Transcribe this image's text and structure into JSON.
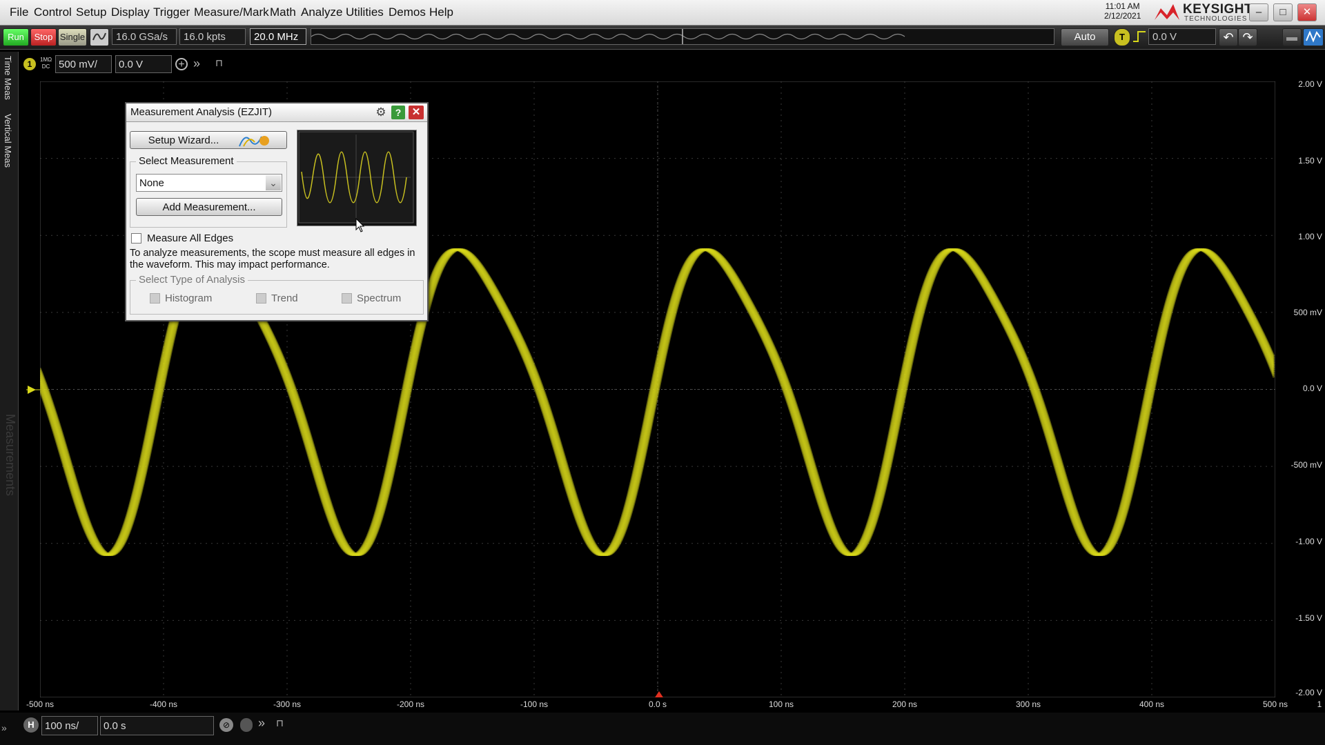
{
  "menu": [
    "File",
    "Control",
    "Setup",
    "Display",
    "Trigger",
    "Measure/Mark",
    "Math",
    "Analyze",
    "Utilities",
    "Demos",
    "Help"
  ],
  "clock": {
    "time": "11:01 AM",
    "date": "2/12/2021"
  },
  "brand": {
    "name": "KEYSIGHT",
    "sub": "TECHNOLOGIES"
  },
  "toolbar": {
    "run": "Run",
    "stop": "Stop",
    "single": "Single",
    "sample_rate": "16.0 GSa/s",
    "memory_depth": "16.0 kpts",
    "bandwidth": "20.0 MHz",
    "trigger_mode": "Auto",
    "trigger_level": "0.0 V",
    "trigger_icon": "T"
  },
  "channel": {
    "number": "1",
    "coupling_top": "1MΩ",
    "coupling_bottom": "DC",
    "scale": "500 mV/",
    "offset": "0.0 V"
  },
  "left_tabs": [
    "Time Meas",
    "Vertical Meas"
  ],
  "measurements_watermark": "Measurements",
  "y_axis": [
    "2.00 V",
    "1.50 V",
    "1.00 V",
    "500 mV",
    "0.0 V",
    "-500 mV",
    "-1.00 V",
    "-1.50 V",
    "-2.00 V"
  ],
  "x_axis": [
    "-500 ns",
    "-400 ns",
    "-300 ns",
    "-200 ns",
    "-100 ns",
    "0.0 s",
    "100 ns",
    "200 ns",
    "300 ns",
    "400 ns",
    "500 ns"
  ],
  "x_axis_extra": "1",
  "timebase": {
    "label": "H",
    "scale": "100 ns/",
    "position": "0.0 s"
  },
  "dialog": {
    "title": "Measurement Analysis (EZJIT)",
    "setup_wizard": "Setup Wizard...",
    "select_measurement": "Select Measurement",
    "measurement_value": "None",
    "add_measurement": "Add Measurement...",
    "measure_all_edges": "Measure All Edges",
    "info": "To analyze measurements, the scope must measure all edges in the waveform. This may impact performance.",
    "analysis_type": "Select Type of Analysis",
    "histogram": "Histogram",
    "trend": "Trend",
    "spectrum": "Spectrum"
  },
  "colors": {
    "trace": "#d8d81a",
    "run": "#3fbf3f",
    "stop": "#d43030",
    "single": "#c8c8a0",
    "dialog_bg": "#f0f0f0"
  }
}
